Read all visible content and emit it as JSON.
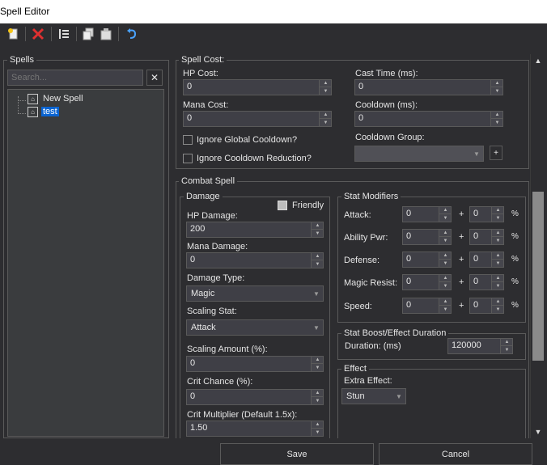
{
  "window": {
    "title": "Spell Editor"
  },
  "toolbar": {
    "new_icon": "new-spell-icon",
    "delete_icon": "delete-icon",
    "list_icon": "list-icon",
    "copy_icon": "copy-icon",
    "paste_icon": "paste-icon",
    "undo_icon": "undo-icon"
  },
  "spells": {
    "legend": "Spells",
    "search_placeholder": "Search...",
    "clear": "✕",
    "items": [
      {
        "label": "New Spell",
        "selected": false
      },
      {
        "label": "test",
        "selected": true
      }
    ]
  },
  "spell_cost": {
    "legend": "Spell Cost:",
    "hp_cost_label": "HP Cost:",
    "hp_cost": "0",
    "mana_cost_label": "Mana Cost:",
    "mana_cost": "0",
    "cast_time_label": "Cast Time (ms):",
    "cast_time": "0",
    "cooldown_label": "Cooldown (ms):",
    "cooldown": "0",
    "ignore_gcd_label": "Ignore Global Cooldown?",
    "ignore_cdr_label": "Ignore Cooldown Reduction?",
    "cooldown_group_label": "Cooldown Group:",
    "cooldown_group": "",
    "add_group": "+"
  },
  "combat_spell": {
    "legend": "Combat Spell",
    "damage": {
      "legend": "Damage",
      "friendly_label": "Friendly",
      "hp_damage_label": "HP Damage:",
      "hp_damage": "200",
      "mana_damage_label": "Mana Damage:",
      "mana_damage": "0",
      "damage_type_label": "Damage Type:",
      "damage_type": "Magic",
      "scaling_stat_label": "Scaling Stat:",
      "scaling_stat": "Attack",
      "scaling_amount_label": "Scaling Amount (%):",
      "scaling_amount": "0",
      "crit_chance_label": "Crit Chance (%):",
      "crit_chance": "0",
      "crit_multiplier_label": "Crit Multiplier (Default 1.5x):",
      "crit_multiplier": "1.50"
    },
    "stat_modifiers": {
      "legend": "Stat Modifiers",
      "rows": [
        {
          "label": "Attack:",
          "flat": "0",
          "pct": "0"
        },
        {
          "label": "Ability Pwr:",
          "flat": "0",
          "pct": "0"
        },
        {
          "label": "Defense:",
          "flat": "0",
          "pct": "0"
        },
        {
          "label": "Magic Resist:",
          "flat": "0",
          "pct": "0"
        },
        {
          "label": "Speed:",
          "flat": "0",
          "pct": "0"
        }
      ],
      "plus": "+",
      "percent": "%"
    },
    "duration": {
      "legend": "Stat Boost/Effect Duration",
      "label": "Duration: (ms)",
      "value": "120000"
    },
    "effect": {
      "legend": "Effect",
      "extra_effect_label": "Extra Effect:",
      "extra_effect": "Stun"
    }
  },
  "footer": {
    "save": "Save",
    "cancel": "Cancel"
  }
}
